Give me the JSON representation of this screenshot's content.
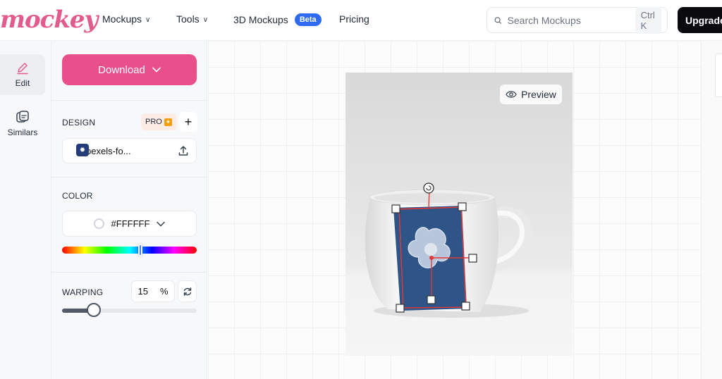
{
  "brand": {
    "logo_text": "mockey",
    "accent": "#e94f8b"
  },
  "nav": {
    "items": [
      {
        "label": "Mockups",
        "has_dropdown": true
      },
      {
        "label": "Tools",
        "has_dropdown": true
      },
      {
        "label": "3D Mockups",
        "badge": "Beta"
      },
      {
        "label": "Pricing"
      }
    ],
    "search": {
      "placeholder": "Search Mockups",
      "shortcut": "Ctrl K"
    },
    "upgrade_label": "Upgrade"
  },
  "rail": {
    "items": [
      {
        "label": "Edit",
        "icon": "pencil-icon",
        "active": true
      },
      {
        "label": "Similars",
        "icon": "stack-icon",
        "active": false
      }
    ]
  },
  "panel": {
    "download_label": "Download",
    "design": {
      "label": "DESIGN",
      "pro_label": "PRO",
      "add_icon": "plus-icon",
      "file_name": "pexels-fo...",
      "upload_icon": "upload-icon"
    },
    "color": {
      "label": "COLOR",
      "value": "#FFFFFF",
      "hue_position": 0.58
    },
    "warping": {
      "label": "WARPING",
      "value": "15",
      "unit": "%",
      "slider_fraction": 0.15
    }
  },
  "canvas": {
    "preview_label": "Preview",
    "design_color": "#2e5488"
  }
}
